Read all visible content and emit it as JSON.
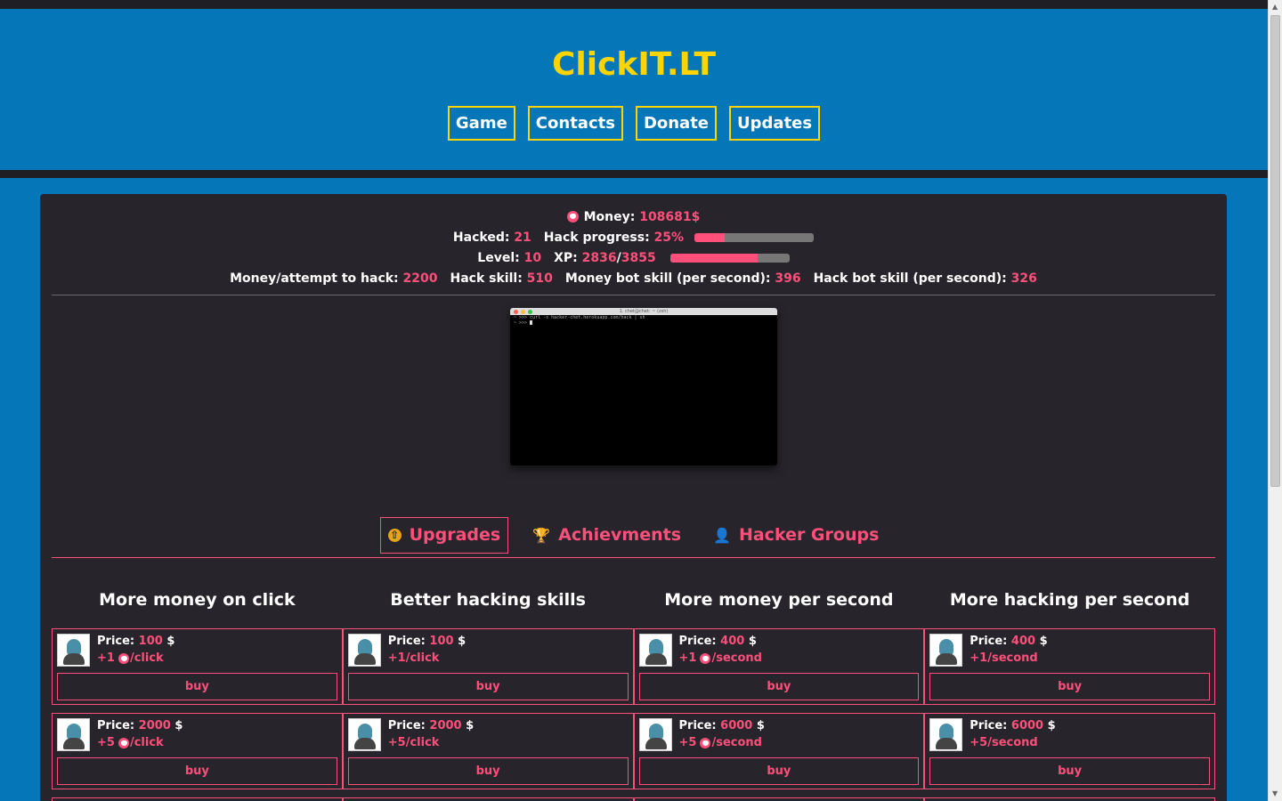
{
  "site": {
    "title": "ClickIT.LT"
  },
  "nav": [
    {
      "label": "Game"
    },
    {
      "label": "Contacts"
    },
    {
      "label": "Donate"
    },
    {
      "label": "Updates"
    }
  ],
  "stats": {
    "money_label": "Money:",
    "money_value": "108681$",
    "hacked_label": "Hacked:",
    "hacked_value": "21",
    "hack_progress_label": "Hack progress:",
    "hack_progress_value": "25%",
    "hack_progress_fraction": 0.25,
    "level_label": "Level:",
    "level_value": "10",
    "xp_label": "XP:",
    "xp_value": "2836",
    "xp_sep": "/",
    "xp_max": "3855",
    "xp_fraction": 0.736,
    "money_per_attempt_label": "Money/attempt to hack:",
    "money_per_attempt_value": "2200",
    "hack_skill_label": "Hack skill:",
    "hack_skill_value": "510",
    "money_bot_label": "Money bot skill (per second):",
    "money_bot_value": "396",
    "hack_bot_label": "Hack bot skill (per second):",
    "hack_bot_value": "326"
  },
  "terminal": {
    "title": "1. chet@chet: ~ (zsh)",
    "line1": "~ >>> curl -s hacker-chet.herokuapp.com/hack | sh",
    "line2": "~ >>> "
  },
  "tabs": [
    {
      "label": "Upgrades",
      "icon": "upgrade-arrow-icon",
      "glyph": "⇧"
    },
    {
      "label": "Achievments",
      "icon": "trophy-icon",
      "glyph": "🏆"
    },
    {
      "label": "Hacker Groups",
      "icon": "hacker-group-icon",
      "glyph": "👤"
    }
  ],
  "columns": [
    {
      "title": "More money on click",
      "cards": [
        {
          "price_label": "Price:",
          "price": "100",
          "currency": "$",
          "bonus_prefix": "+1",
          "heart": true,
          "bonus_suffix": "/click",
          "buy": "buy"
        },
        {
          "price_label": "Price:",
          "price": "2000",
          "currency": "$",
          "bonus_prefix": "+5",
          "heart": true,
          "bonus_suffix": "/click",
          "buy": "buy"
        }
      ]
    },
    {
      "title": "Better hacking skills",
      "cards": [
        {
          "price_label": "Price:",
          "price": "100",
          "currency": "$",
          "bonus_prefix": "+1",
          "heart": false,
          "bonus_suffix": "/click",
          "buy": "buy"
        },
        {
          "price_label": "Price:",
          "price": "2000",
          "currency": "$",
          "bonus_prefix": "+5",
          "heart": false,
          "bonus_suffix": "/click",
          "buy": "buy"
        }
      ]
    },
    {
      "title": "More money per second",
      "cards": [
        {
          "price_label": "Price:",
          "price": "400",
          "currency": "$",
          "bonus_prefix": "+1",
          "heart": true,
          "bonus_suffix": "/second",
          "buy": "buy"
        },
        {
          "price_label": "Price:",
          "price": "6000",
          "currency": "$",
          "bonus_prefix": "+5",
          "heart": true,
          "bonus_suffix": "/second",
          "buy": "buy"
        }
      ]
    },
    {
      "title": "More hacking per second",
      "cards": [
        {
          "price_label": "Price:",
          "price": "400",
          "currency": "$",
          "bonus_prefix": "+1",
          "heart": false,
          "bonus_suffix": "/second",
          "buy": "buy"
        },
        {
          "price_label": "Price:",
          "price": "6000",
          "currency": "$",
          "bonus_prefix": "+5",
          "heart": false,
          "bonus_suffix": "/second",
          "buy": "buy"
        }
      ]
    }
  ],
  "colors": {
    "background": "#0577b8",
    "accent": "#ff4f7b",
    "title": "#ffd400",
    "panel": "#27252b"
  }
}
